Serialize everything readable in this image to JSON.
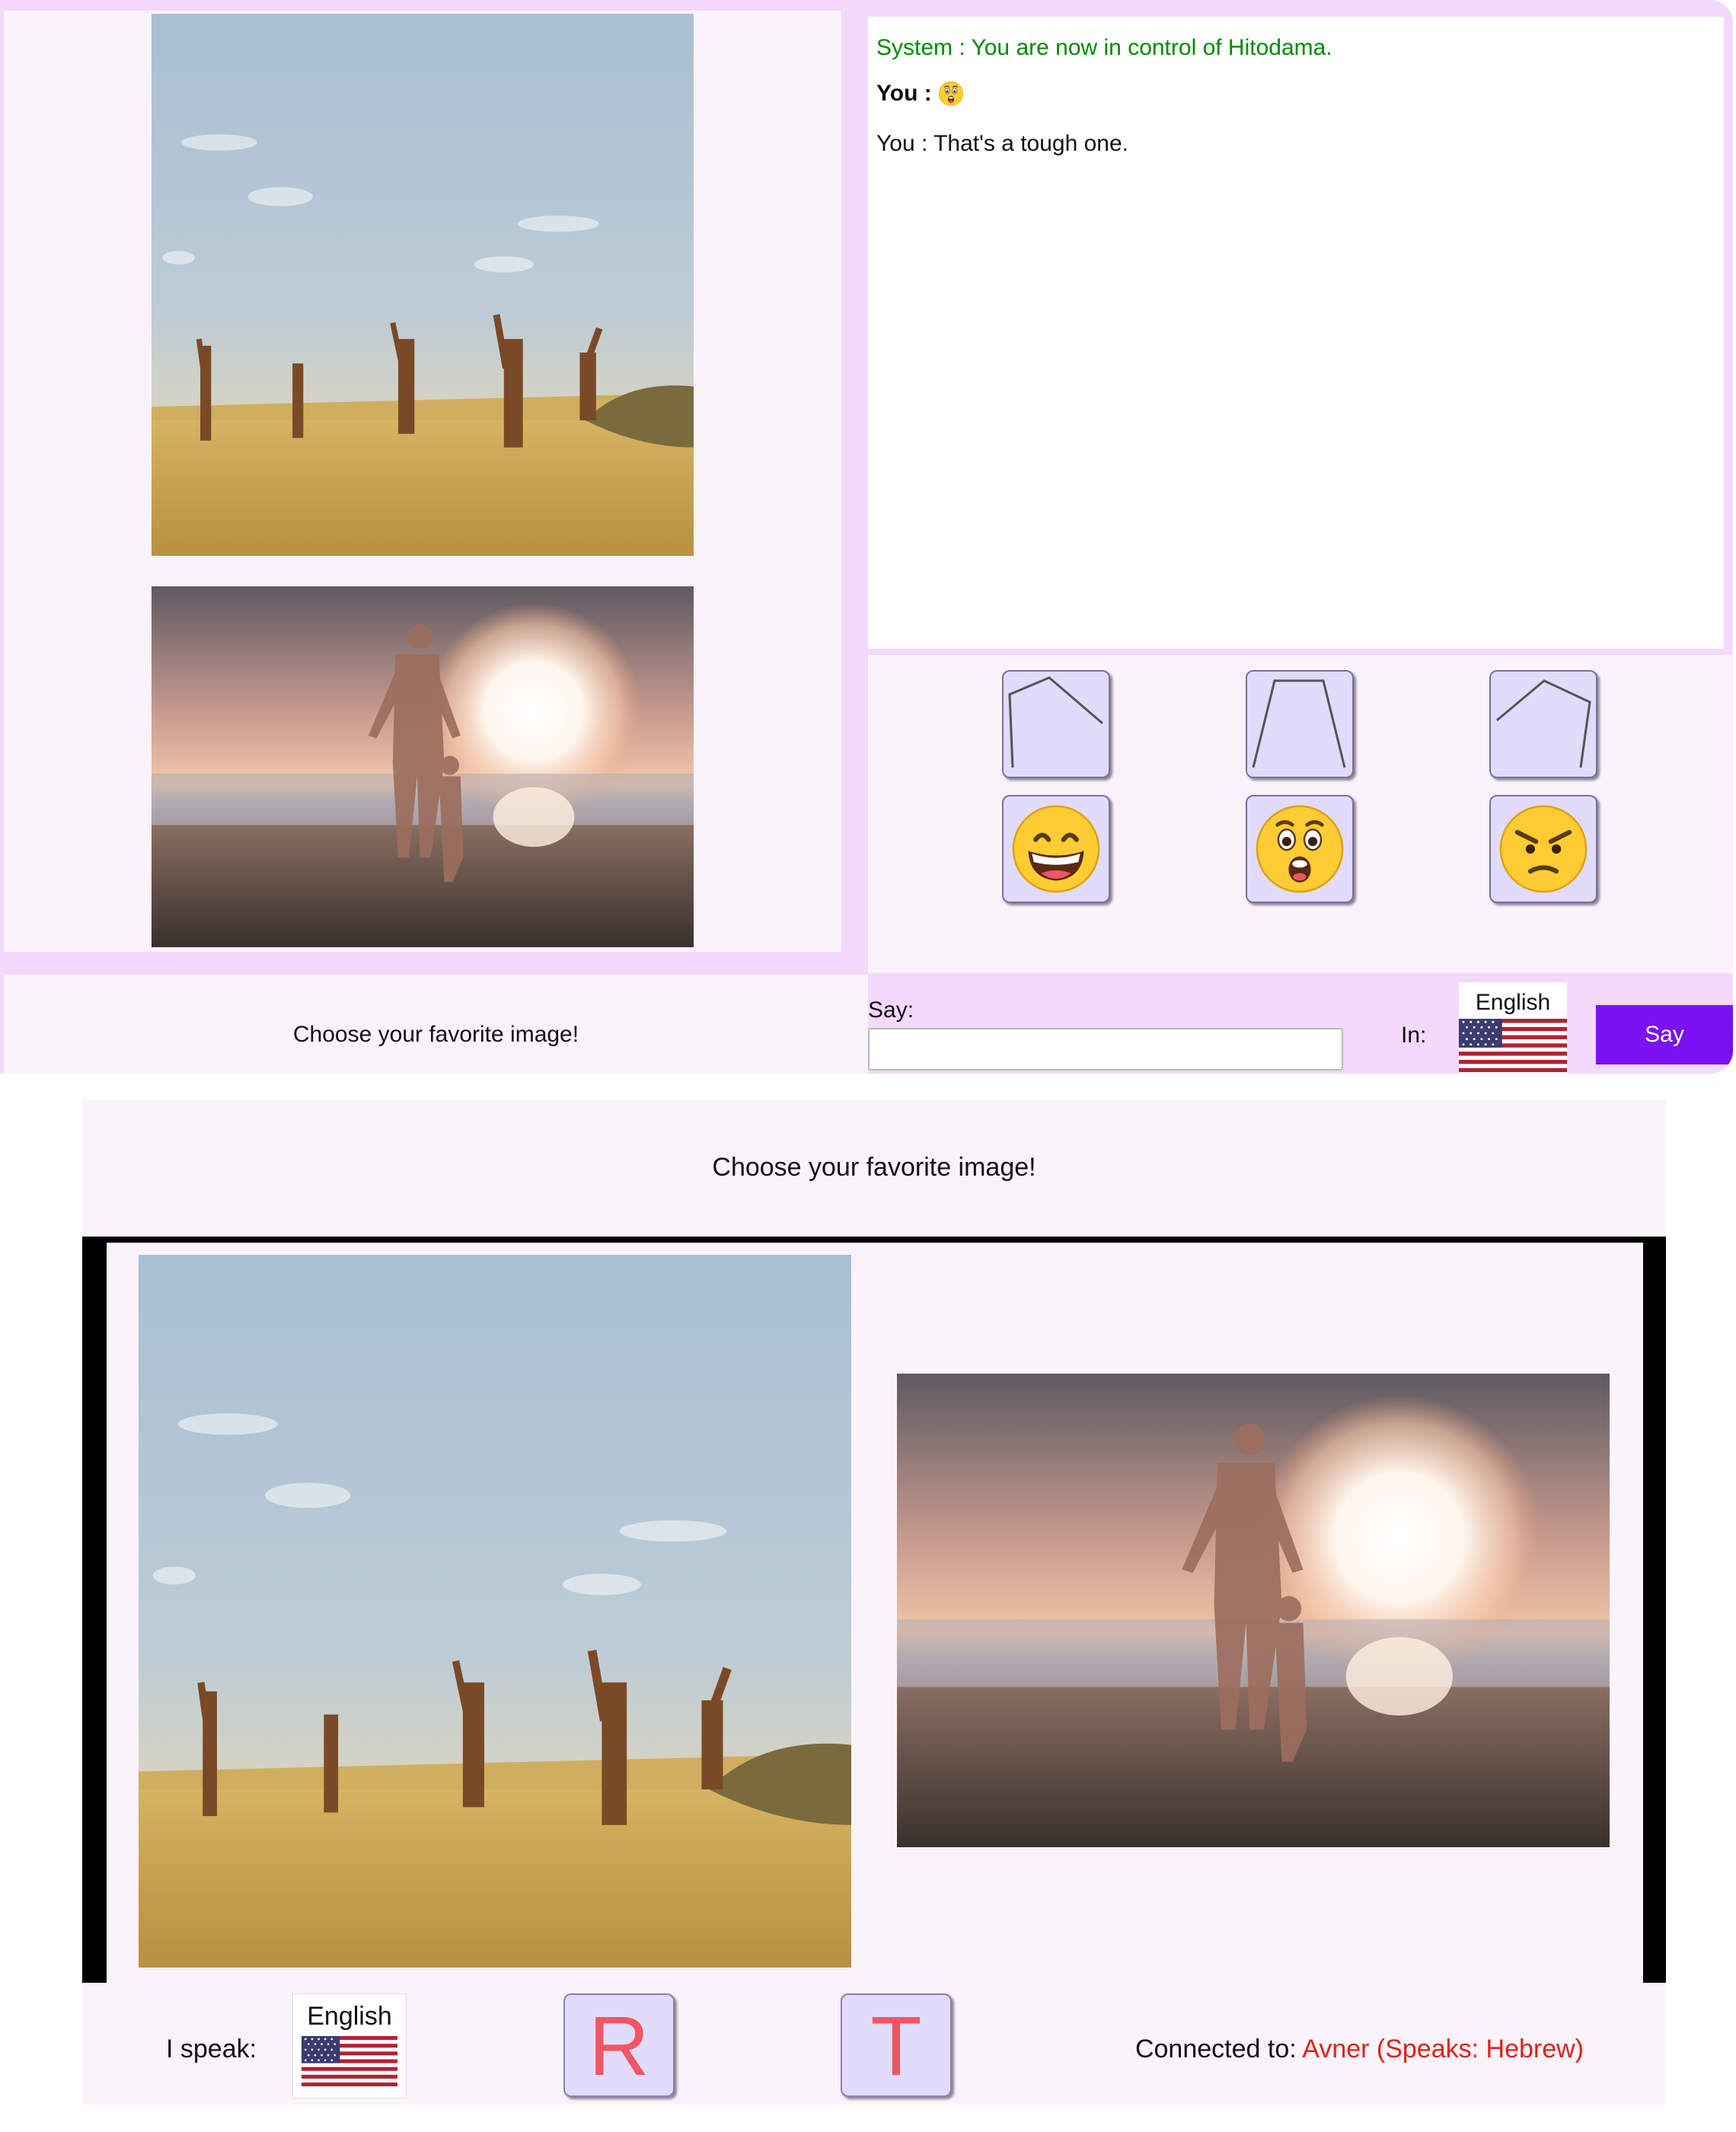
{
  "chat": {
    "messages": [
      {
        "text": "System : You are now in control of Hitodama.",
        "color": "#008a00"
      },
      {
        "speaker": "You :",
        "emoji": "astonished-face"
      },
      {
        "text": "You : That's a tough one."
      }
    ]
  },
  "controls": {
    "shape_buttons": [
      "pentagon-open-shape",
      "trapezoid-shape",
      "pentagon-shape"
    ],
    "emoji_buttons": [
      "grinning-face",
      "astonished-face",
      "angry-face"
    ]
  },
  "footer": {
    "prompt": "Choose your favorite image!",
    "say_label": "Say:",
    "say_value": "",
    "in_label": "In:",
    "language": "English",
    "say_button": "Say"
  },
  "bottom": {
    "title": "Choose your favorite image!",
    "i_speak_label": "I speak:",
    "language": "English",
    "letter_buttons": [
      "R",
      "T"
    ],
    "connected_label": "Connected to:",
    "connected_name": "Avner (Speaks: Hebrew)",
    "connected_color": "#e0201a"
  },
  "images": [
    "giraffes-photo",
    "beach-sunset-photo"
  ],
  "colors": {
    "accent": "#7a12f2",
    "panel": "#fbf3fb",
    "frame": "#f3d9fb",
    "button_bg": "#e1dcfb"
  }
}
